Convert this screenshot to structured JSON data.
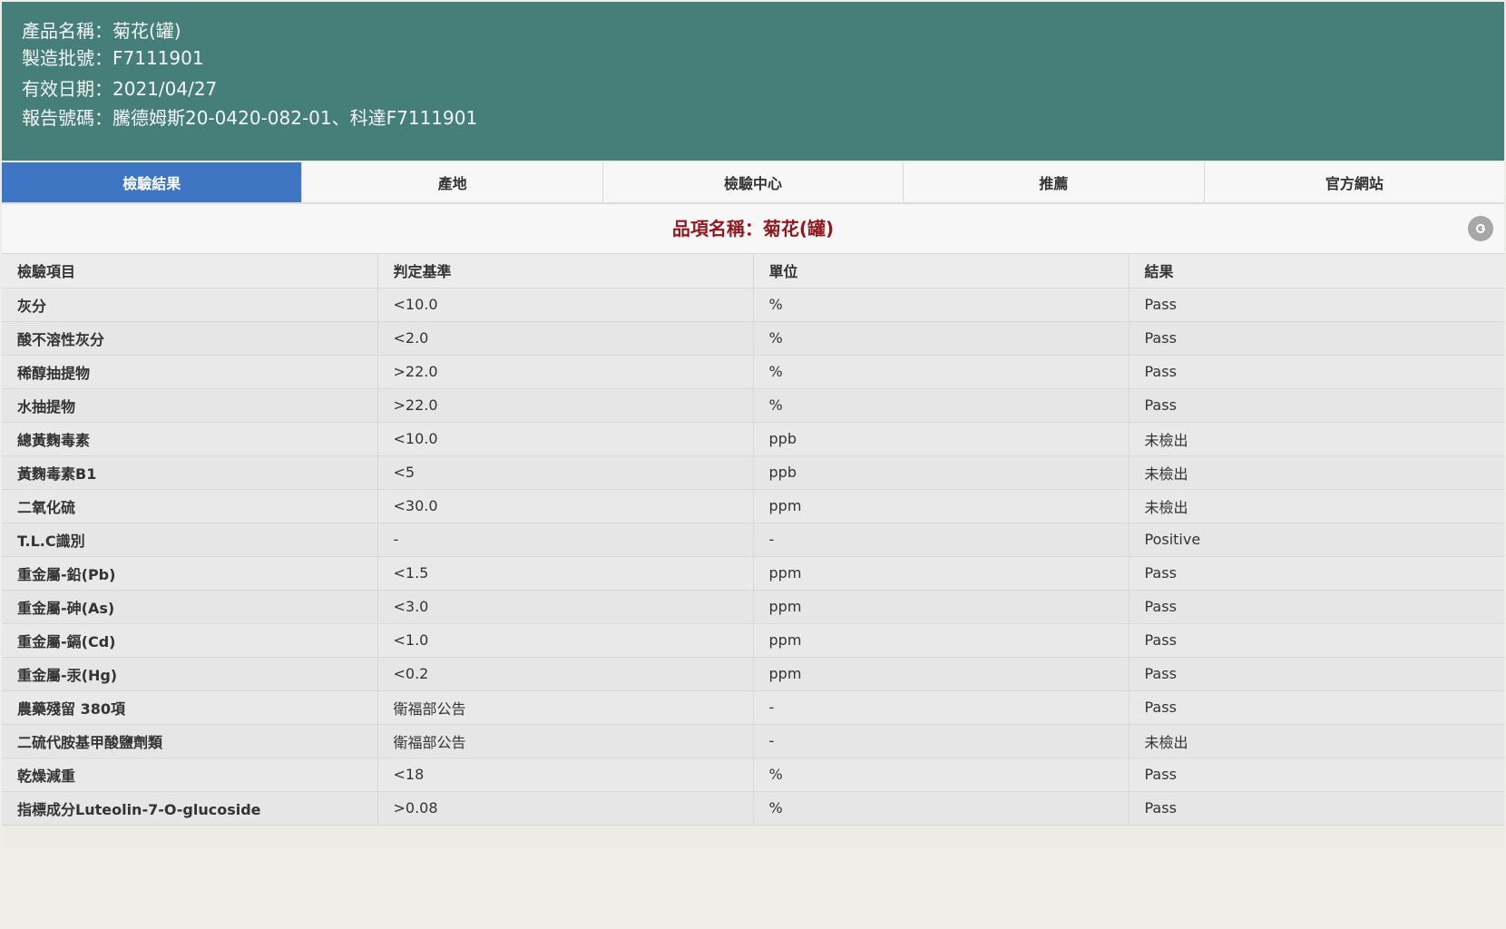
{
  "header": {
    "product_name": "產品名稱：菊花(罐)",
    "batch_number": "製造批號：F7111901",
    "expiry_date": "有效日期：2021/04/27",
    "report_number": "報告號碼：騰德姆斯20-0420-082-01、科達F7111901"
  },
  "tabs": [
    {
      "label": "檢驗結果",
      "active": true
    },
    {
      "label": "產地",
      "active": false
    },
    {
      "label": "檢驗中心",
      "active": false
    },
    {
      "label": "推薦",
      "active": false
    },
    {
      "label": "官方網站",
      "active": false
    }
  ],
  "title": {
    "label": "品項名稱：",
    "value": "菊花(罐)"
  },
  "table": {
    "headers": [
      "檢驗項目",
      "判定基準",
      "單位",
      "結果"
    ],
    "rows": [
      [
        "灰分",
        "<10.0",
        "%",
        "Pass"
      ],
      [
        "酸不溶性灰分",
        "<2.0",
        "%",
        "Pass"
      ],
      [
        "稀醇抽提物",
        ">22.0",
        "%",
        "Pass"
      ],
      [
        "水抽提物",
        ">22.0",
        "%",
        "Pass"
      ],
      [
        "總黃麴毒素",
        "<10.0",
        "ppb",
        "未檢出"
      ],
      [
        "黃麴毒素B1",
        "<5",
        "ppb",
        "未檢出"
      ],
      [
        "二氧化硫",
        "<30.0",
        "ppm",
        "未檢出"
      ],
      [
        "T.L.C識別",
        "-",
        "-",
        "Positive"
      ],
      [
        "重金屬-鉛(Pb)",
        "<1.5",
        "ppm",
        "Pass"
      ],
      [
        "重金屬-砷(As)",
        "<3.0",
        "ppm",
        "Pass"
      ],
      [
        "重金屬-鎘(Cd)",
        "<1.0",
        "ppm",
        "Pass"
      ],
      [
        "重金屬-汞(Hg)",
        "<0.2",
        "ppm",
        "Pass"
      ],
      [
        "農藥殘留 380項",
        "衛福部公告",
        "-",
        "Pass"
      ],
      [
        "二硫代胺基甲酸鹽劑類",
        "衛福部公告",
        "-",
        "未檢出"
      ],
      [
        "乾燥減重",
        "<18",
        "%",
        "Pass"
      ],
      [
        "指標成分Luteolin-7-O-glucoside",
        ">0.08",
        "%",
        "Pass"
      ]
    ]
  },
  "colors": {
    "header_bg": "#467f7a",
    "active_tab": "#3f76c4",
    "title_color": "#8e1a20"
  }
}
